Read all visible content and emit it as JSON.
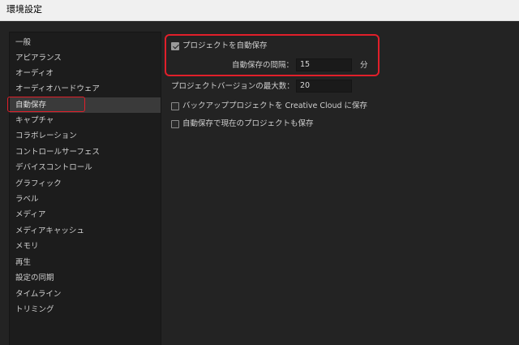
{
  "window": {
    "title": "環境設定"
  },
  "sidebar": {
    "items": [
      {
        "label": "一般",
        "selected": false
      },
      {
        "label": "アピアランス",
        "selected": false
      },
      {
        "label": "オーディオ",
        "selected": false
      },
      {
        "label": "オーディオハードウェア",
        "selected": false
      },
      {
        "label": "自動保存",
        "selected": true
      },
      {
        "label": "キャプチャ",
        "selected": false
      },
      {
        "label": "コラボレーション",
        "selected": false
      },
      {
        "label": "コントロールサーフェス",
        "selected": false
      },
      {
        "label": "デバイスコントロール",
        "selected": false
      },
      {
        "label": "グラフィック",
        "selected": false
      },
      {
        "label": "ラベル",
        "selected": false
      },
      {
        "label": "メディア",
        "selected": false
      },
      {
        "label": "メディアキャッシュ",
        "selected": false
      },
      {
        "label": "メモリ",
        "selected": false
      },
      {
        "label": "再生",
        "selected": false
      },
      {
        "label": "設定の同期",
        "selected": false
      },
      {
        "label": "タイムライン",
        "selected": false
      },
      {
        "label": "トリミング",
        "selected": false
      }
    ]
  },
  "autosave": {
    "auto_save_label": "プロジェクトを自動保存",
    "auto_save_checked": true,
    "interval_label": "自動保存の間隔：",
    "interval_value": "15",
    "interval_unit": "分",
    "max_versions_label": "プロジェクトバージョンの最大数：",
    "max_versions_value": "20",
    "backup_cc_label": "バックアッププロジェクトを Creative Cloud に保存",
    "backup_cc_checked": false,
    "save_current_label": "自動保存で現在のプロジェクトも保存",
    "save_current_checked": false
  },
  "colors": {
    "highlight": "#e11f2a",
    "background": "#232323",
    "selected_item": "#3a3a3a"
  }
}
